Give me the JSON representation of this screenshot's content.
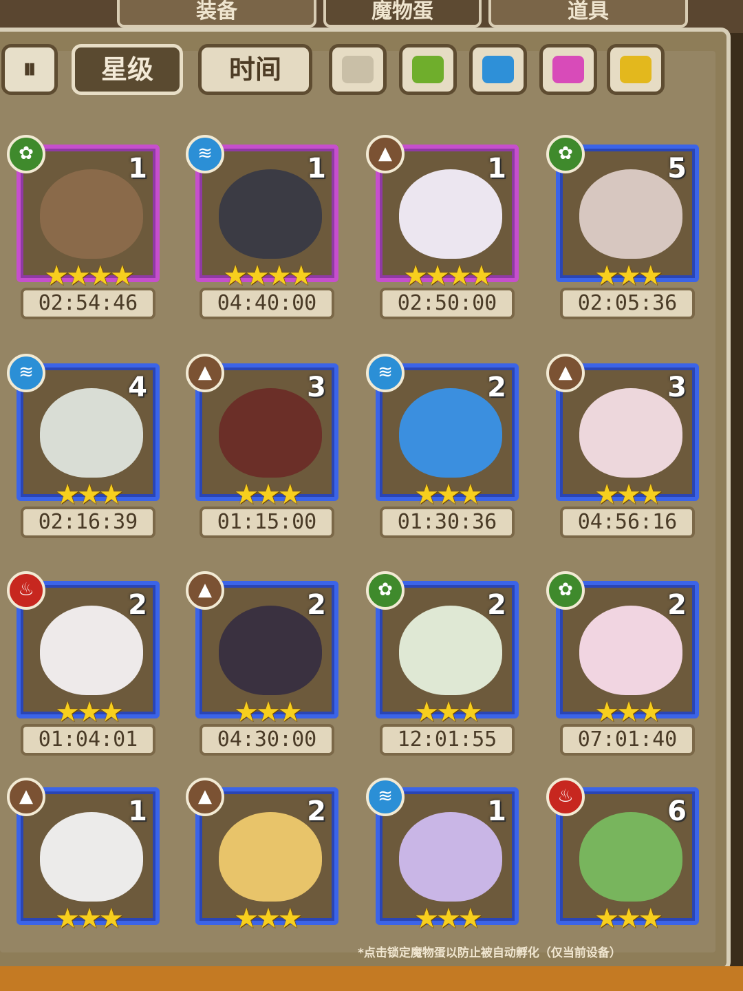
{
  "top_tabs": [
    {
      "label": "装备"
    },
    {
      "label": "魔物蛋"
    },
    {
      "label": "道具"
    }
  ],
  "toolbar": {
    "sort_icon": "sort-toggle-icon",
    "sort_glyph": "⏸",
    "star_label": "星级",
    "time_label": "时间",
    "active_filter": "星级",
    "color_filters": [
      {
        "name": "gray",
        "color": "#c9bfa7"
      },
      {
        "name": "green",
        "color": "#6fae2c"
      },
      {
        "name": "blue",
        "color": "#2e90d8"
      },
      {
        "name": "pink",
        "color": "#d84bb9"
      },
      {
        "name": "yellow",
        "color": "#e3b81d"
      }
    ]
  },
  "eggs": [
    {
      "element": "grass",
      "element_glyph": "✿",
      "level": "1",
      "stars": 4,
      "rarity": "purple",
      "timer": "02:54:46",
      "monster_color": "#8a6a4a"
    },
    {
      "element": "water",
      "element_glyph": "≋",
      "level": "1",
      "stars": 4,
      "rarity": "purple",
      "timer": "04:40:00",
      "monster_color": "#3b3b44"
    },
    {
      "element": "earth",
      "element_glyph": "▲",
      "level": "1",
      "stars": 4,
      "rarity": "purple",
      "timer": "02:50:00",
      "monster_color": "#ece6f0"
    },
    {
      "element": "grass",
      "element_glyph": "✿",
      "level": "5",
      "stars": 3,
      "rarity": "blue",
      "timer": "02:05:36",
      "monster_color": "#d7c7c0"
    },
    {
      "element": "water",
      "element_glyph": "≋",
      "level": "4",
      "stars": 3,
      "rarity": "blue",
      "timer": "02:16:39",
      "monster_color": "#d9ddd5"
    },
    {
      "element": "earth",
      "element_glyph": "▲",
      "level": "3",
      "stars": 3,
      "rarity": "blue",
      "timer": "01:15:00",
      "monster_color": "#6b2f28"
    },
    {
      "element": "water",
      "element_glyph": "≋",
      "level": "2",
      "stars": 3,
      "rarity": "blue",
      "timer": "01:30:36",
      "monster_color": "#3b8fdf"
    },
    {
      "element": "earth",
      "element_glyph": "▲",
      "level": "3",
      "stars": 3,
      "rarity": "blue",
      "timer": "04:56:16",
      "monster_color": "#edd7dc"
    },
    {
      "element": "fire",
      "element_glyph": "♨",
      "level": "2",
      "stars": 3,
      "rarity": "blue",
      "timer": "01:04:01",
      "monster_color": "#eeeaea"
    },
    {
      "element": "earth",
      "element_glyph": "▲",
      "level": "2",
      "stars": 3,
      "rarity": "blue",
      "timer": "04:30:00",
      "monster_color": "#3a3140"
    },
    {
      "element": "grass",
      "element_glyph": "✿",
      "level": "2",
      "stars": 3,
      "rarity": "blue",
      "timer": "12:01:55",
      "monster_color": "#dfe8d4"
    },
    {
      "element": "grass",
      "element_glyph": "✿",
      "level": "2",
      "stars": 3,
      "rarity": "blue",
      "timer": "07:01:40",
      "monster_color": "#f1d5e1"
    },
    {
      "element": "earth",
      "element_glyph": "▲",
      "level": "1",
      "stars": 3,
      "rarity": "blue",
      "timer": "",
      "monster_color": "#ecebea"
    },
    {
      "element": "earth",
      "element_glyph": "▲",
      "level": "2",
      "stars": 3,
      "rarity": "blue",
      "timer": "",
      "monster_color": "#e8c46a"
    },
    {
      "element": "water",
      "element_glyph": "≋",
      "level": "1",
      "stars": 3,
      "rarity": "blue",
      "timer": "",
      "monster_color": "#c9b6e6"
    },
    {
      "element": "fire",
      "element_glyph": "♨",
      "level": "6",
      "stars": 3,
      "rarity": "blue",
      "timer": "",
      "monster_color": "#78b55d"
    }
  ],
  "footnote": "*点击锁定魔物蛋以防止被自动孵化（仅当前设备）"
}
